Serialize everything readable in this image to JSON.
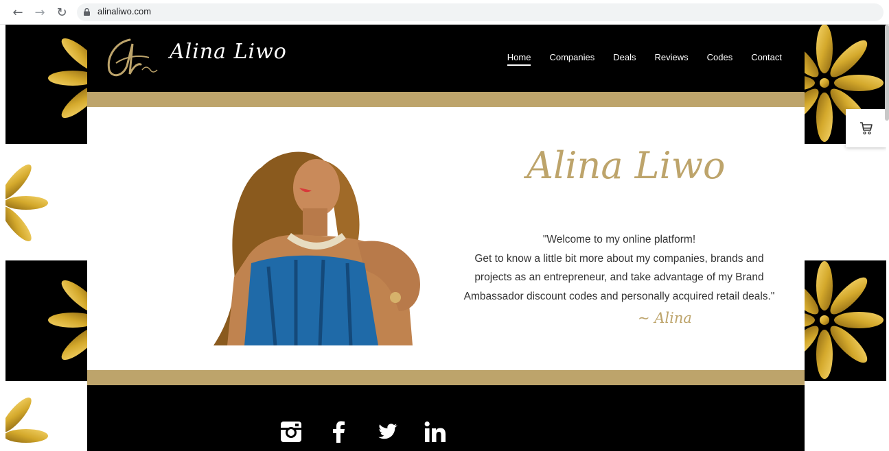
{
  "browser": {
    "back_icon": "back-arrow-icon",
    "back_glyph": "←",
    "forward_icon": "forward-arrow-icon",
    "forward_glyph": "→",
    "reload_icon": "reload-icon",
    "reload_glyph": "↻",
    "lock_icon": "lock-icon",
    "url": "alinaliwo.com"
  },
  "header": {
    "logo_icon": "alina-logo-icon",
    "site_title": "Alina Liwo",
    "nav": [
      "Home",
      "Companies",
      "Deals",
      "Reviews",
      "Codes",
      "Contact"
    ],
    "active_nav": "Home"
  },
  "hero": {
    "portrait": "alina-portrait-image",
    "title": "Alina Liwo",
    "quote_lines": [
      "\"Welcome to my online platform!",
      "Get to know a little bit more about my companies, brands and",
      "projects as an entrepreneur, and take advantage of my Brand",
      "Ambassador discount codes and personally acquired retail deals.\""
    ],
    "signature": "~ Alina"
  },
  "footer": {
    "social_icons": [
      "instagram-icon",
      "facebook-icon",
      "twitter-icon",
      "linkedin-icon"
    ]
  },
  "cart": {
    "icon": "cart-icon"
  },
  "colors": {
    "gold": "#bda46b",
    "black": "#000000",
    "petal_gold": "#d4a92c",
    "white": "#ffffff"
  }
}
